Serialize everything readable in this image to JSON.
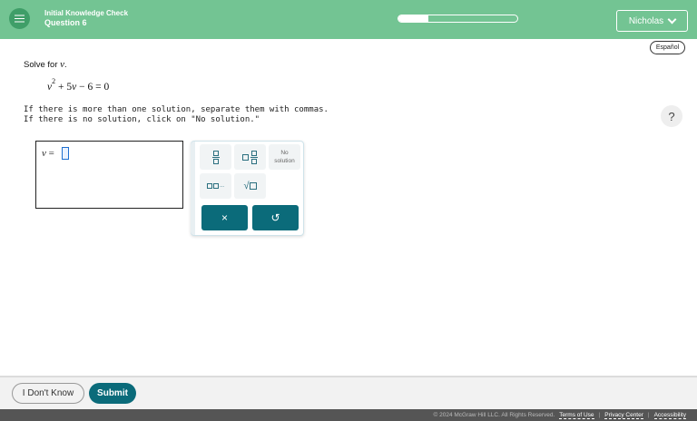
{
  "header": {
    "title": "Initial Knowledge Check",
    "subtitle": "Question 6",
    "progress_fraction": 0.25,
    "user_name": "Nicholas"
  },
  "language_button": "Español",
  "question": {
    "prompt_text": "Solve for",
    "variable": "v",
    "prompt_end": ".",
    "equation": {
      "base": "v",
      "exponent": "2",
      "rest_a": " + 5",
      "rest_var": "v",
      "rest_b": " − 6 = 0"
    },
    "instruction_1": "If there is more than one solution, separate them with commas.",
    "instruction_2": "If there is no solution, click on \"No solution.\""
  },
  "help_label": "?",
  "answer": {
    "label_var": "v",
    "label_eq": " ="
  },
  "palette": {
    "no_solution_label_1": "No",
    "no_solution_label_2": "solution",
    "list_key_suffix": "...",
    "clear_symbol": "×",
    "undo_symbol": "↺"
  },
  "footer": {
    "dont_know": "I Don't Know",
    "submit": "Submit",
    "copyright": "© 2024 McGraw Hill LLC. All Rights Reserved.",
    "terms": "Terms of Use",
    "privacy": "Privacy Center",
    "accessibility": "Accessibility",
    "separator": "|"
  },
  "colors": {
    "header_green": "#73c493",
    "teal": "#0b6b7a"
  }
}
